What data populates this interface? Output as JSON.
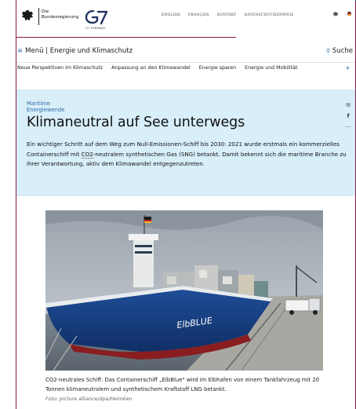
{
  "header": {
    "brand_line1": "Die",
    "brand_line2": "Bundesregierung",
    "g7_caption": "G7 GERMANY",
    "meta_nav": [
      "ENGLISH",
      "FRANÇAIS",
      "KONTAKT",
      "DATENSCHUTZHINWEIS"
    ],
    "meta_icons": [
      "eagle-icon",
      "flag-icon",
      "more-icon"
    ]
  },
  "navbar": {
    "menu_icon": "≡",
    "menu_label": "Menü",
    "breadcrumb": "Energie und Klimaschutz",
    "search_label": "Suche"
  },
  "tabs": [
    "Neue Perspektiven im Klimaschutz",
    "Anpassung an den Klimawandel",
    "Energie sparen",
    "Energie und Mobilität"
  ],
  "tabs_more": "+",
  "hero": {
    "kicker": "Maritime Energiewende",
    "title": "Klimaneutral auf See unterwegs",
    "lead_part1": "Ein wichtiger Schritt auf dem Weg zum Null-Emissionen-Schiff bis 2030: 2021 wurde erstmals ein kommerzielles Containerschiff mit ",
    "lead_abbr": "CO2",
    "lead_part2": "-neutralem synthetischen Gas (SNG) betankt. Damit bekennt sich die maritime Branche zu ihrer Verantwortung, aktiv dem Klimawandel entgegenzutreten.",
    "share_icons": [
      "mail-icon",
      "facebook-icon",
      "more-icon"
    ],
    "share_glyphs": [
      "✉",
      "f",
      "···"
    ]
  },
  "article": {
    "ship_name": "ElbBLUE",
    "caption": "CO2-neutrales Schiff: Das Containerschiff „ElbBlue\" wird im Elbhafen von einem Tankfahrzeug mit 20 Tonnen klimaneutralem und synthetischem Kraftstoff LNG betankt.",
    "credit": "Foto: picture alliance/dpa/Heimken"
  },
  "colors": {
    "accent": "#2f6fa8",
    "hero_bg": "#d8eef9",
    "border": "#8b1a4a"
  }
}
